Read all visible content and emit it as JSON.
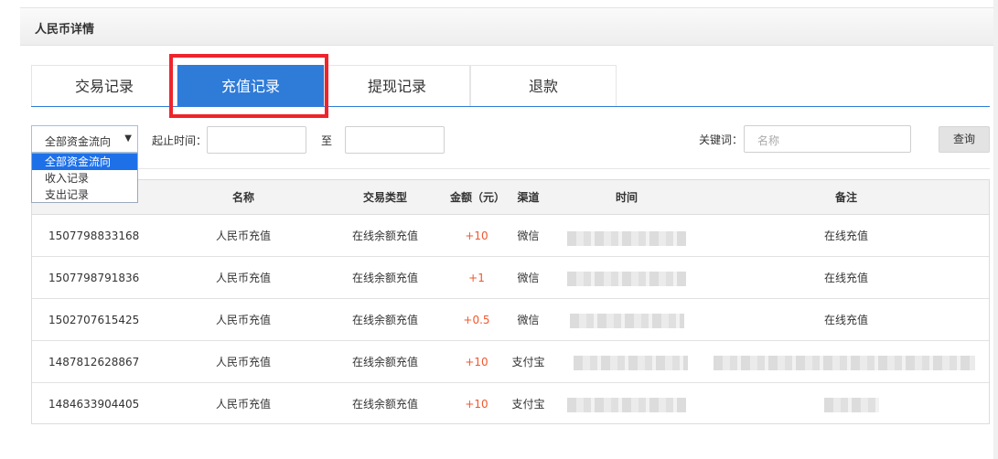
{
  "page": {
    "title": "人民币详情"
  },
  "tabs": [
    {
      "label": "交易记录",
      "active": false
    },
    {
      "label": "充值记录",
      "active": true
    },
    {
      "label": "提现记录",
      "active": false
    },
    {
      "label": "退款",
      "active": false
    }
  ],
  "filters": {
    "flow_select": {
      "value": "全部资金流向",
      "options": [
        "全部资金流向",
        "收入记录",
        "支出记录"
      ],
      "selected_index": 0
    },
    "date_label": "起止时间：",
    "to_label": "至",
    "keyword_label": "关键词：",
    "keyword_placeholder": "名称",
    "query_button": "查询"
  },
  "table": {
    "columns": [
      "名称",
      "交易类型",
      "金额（元）",
      "渠道",
      "时间",
      "备注"
    ],
    "rows": [
      {
        "id": "1507798833168",
        "name": "人民币充值",
        "type": "在线余额充值",
        "amount": "+10",
        "channel": "微信",
        "note": "在线充值"
      },
      {
        "id": "1507798791836",
        "name": "人民币充值",
        "type": "在线余额充值",
        "amount": "+1",
        "channel": "微信",
        "note": "在线充值"
      },
      {
        "id": "1502707615425",
        "name": "人民币充值",
        "type": "在线余额充值",
        "amount": "+0.5",
        "channel": "微信",
        "note": "在线充值"
      },
      {
        "id": "1487812628867",
        "name": "人民币充值",
        "type": "在线余额充值",
        "amount": "+10",
        "channel": "支付宝",
        "note": ""
      },
      {
        "id": "1484633904405",
        "name": "人民币充值",
        "type": "在线余额充值",
        "amount": "+10",
        "channel": "支付宝",
        "note": ""
      }
    ]
  },
  "colors": {
    "accent": "#2f7bd8",
    "highlight": "#f0232b",
    "amount": "#f0582e"
  }
}
